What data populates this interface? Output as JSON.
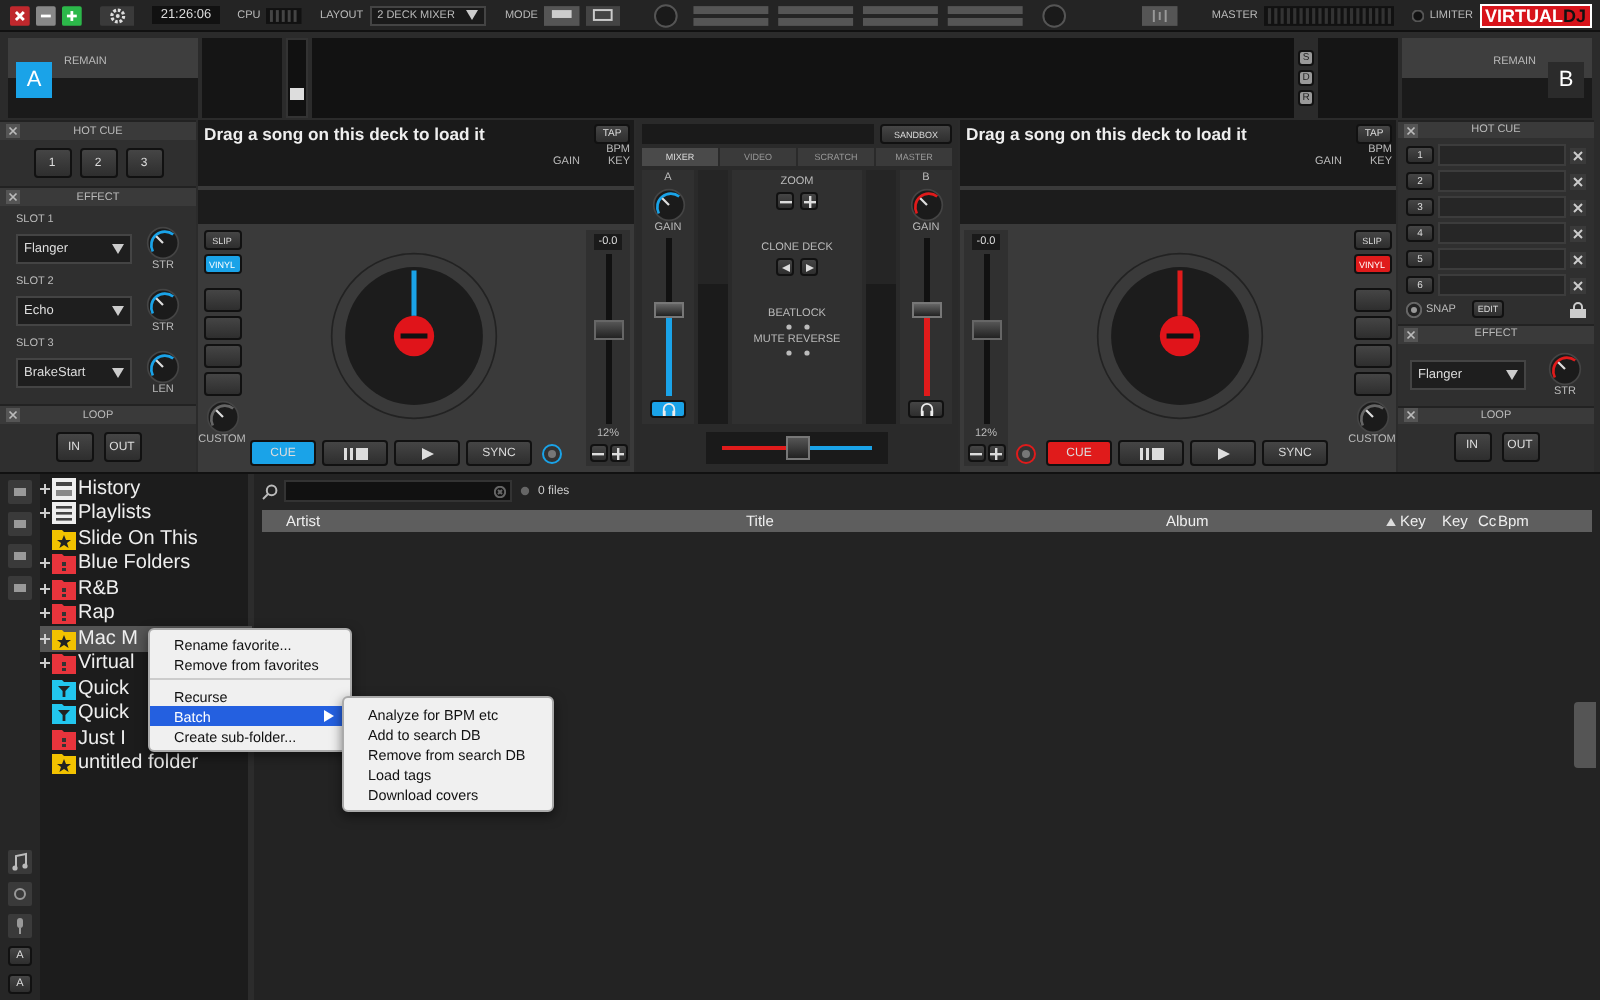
{
  "top_bar": {
    "clock": "21:26:06",
    "cpu_label": "CPU",
    "layout_label": "LAYOUT",
    "layout_value": "2 DECK MIXER",
    "mode_label": "MODE",
    "master_label": "MASTER",
    "limiter_label": "LIMITER",
    "logo": {
      "left": "VIRTUAL",
      "right": "DJ"
    }
  },
  "deck_headers": [
    {
      "letter": "A",
      "remain": "REMAIN",
      "color": "#1aa3e8"
    },
    {
      "letter": "B",
      "remain": "REMAIN",
      "color": "#2b2b2b"
    }
  ],
  "header_slider": {
    "level": 0.3
  },
  "view_buttons": [
    "S",
    "D",
    "R"
  ],
  "left_panel": {
    "hotcue_title": "HOT CUE",
    "hotcues": [
      "1",
      "2",
      "3"
    ],
    "effect_title": "EFFECT",
    "slots": [
      {
        "label": "SLOT 1",
        "effect": "Flanger",
        "knob": "STR"
      },
      {
        "label": "SLOT 2",
        "effect": "Echo",
        "knob": "STR"
      },
      {
        "label": "SLOT 3",
        "effect": "BrakeStart",
        "knob": "LEN"
      }
    ],
    "loop_title": "LOOP",
    "loop_buttons": [
      "IN",
      "OUT"
    ]
  },
  "decks": [
    {
      "color": "#1aa3e8",
      "message": "Drag a song on this deck to load it",
      "tap": "TAP",
      "bpm": "BPM",
      "gain": "GAIN",
      "key": "KEY",
      "slip": "SLIP",
      "vinyl": "VINYL",
      "vinyl_on": true,
      "custom": "CUSTOM",
      "pitch": "-0.0",
      "pitch_range": "12%",
      "pitch_slider": {
        "level": 0.55
      },
      "cue": "CUE",
      "sync": "SYNC"
    },
    {
      "color": "#e01b1b",
      "message": "Drag a song on this deck to load it",
      "tap": "TAP",
      "bpm": "BPM",
      "gain": "GAIN",
      "key": "KEY",
      "slip": "SLIP",
      "vinyl": "VINYL",
      "vinyl_on": true,
      "custom": "CUSTOM",
      "pitch": "-0.0",
      "pitch_range": "12%",
      "pitch_slider": {
        "level": 0.55
      },
      "cue": "CUE",
      "sync": "SYNC"
    }
  ],
  "mixer": {
    "sandbox": "SANDBOX",
    "tabs": [
      {
        "label": "MIXER",
        "selected": true
      },
      {
        "label": "VIDEO",
        "selected": false
      },
      {
        "label": "SCRATCH",
        "selected": false
      },
      {
        "label": "MASTER",
        "selected": false
      }
    ],
    "channels": [
      {
        "letter": "A",
        "gain": "GAIN",
        "color": "#1aa3e8",
        "level": 0.55,
        "headphone_on": true
      },
      {
        "letter": "B",
        "gain": "GAIN",
        "color": "#e01b1b",
        "level": 0.55,
        "headphone_on": false
      }
    ],
    "zoom": "ZOOM",
    "clone_deck": "CLONE DECK",
    "beatlock": "BEATLOCK",
    "mute_reverse": "MUTE REVERSE",
    "crossfader": {
      "level": 0.5
    }
  },
  "right_panel": {
    "hotcue_title": "HOT CUE",
    "hotcues": [
      "1",
      "2",
      "3",
      "4",
      "5",
      "6"
    ],
    "snap": "SNAP",
    "edit": "EDIT",
    "effect_title": "EFFECT",
    "effect": "Flanger",
    "knob": "STR",
    "loop_title": "LOOP",
    "loop_buttons": [
      "IN",
      "OUT"
    ]
  },
  "browser": {
    "sidebar_letters": [
      "A",
      "A"
    ],
    "tree": [
      {
        "label": "History",
        "kind": "history",
        "expandable": true,
        "selected": false
      },
      {
        "label": "Playlists",
        "kind": "playlist",
        "expandable": true,
        "selected": false
      },
      {
        "label": "Slide On This",
        "kind": "favorite",
        "expandable": false,
        "selected": false
      },
      {
        "label": "Blue Folders",
        "kind": "folder",
        "expandable": true,
        "selected": false
      },
      {
        "label": "R&B",
        "kind": "folder",
        "expandable": true,
        "selected": false
      },
      {
        "label": "Rap",
        "kind": "folder",
        "expandable": true,
        "selected": false
      },
      {
        "label": "Mac M",
        "kind": "favorite",
        "expandable": true,
        "selected": true
      },
      {
        "label": "Virtual",
        "kind": "folder",
        "expandable": true,
        "selected": false
      },
      {
        "label": "Quick",
        "kind": "filter",
        "expandable": false,
        "selected": false
      },
      {
        "label": "Quick",
        "kind": "filter",
        "expandable": false,
        "selected": false
      },
      {
        "label": "Just I",
        "kind": "folder",
        "expandable": false,
        "selected": false
      },
      {
        "label": "untitled folder",
        "kind": "favorite",
        "expandable": false,
        "selected": false
      }
    ],
    "file_count": "0 files",
    "columns": [
      {
        "label": "Artist",
        "sorted": false
      },
      {
        "label": "Title",
        "sorted": false
      },
      {
        "label": "Album",
        "sorted": false
      },
      {
        "label": "Key",
        "sorted": true
      },
      {
        "label": "Key",
        "sorted": false
      },
      {
        "label": "Cc",
        "sorted": false
      },
      {
        "label": "Bpm",
        "sorted": false
      }
    ]
  },
  "context_menu": {
    "items": [
      {
        "label": "Rename favorite...",
        "highlighted": false,
        "submenu": false,
        "separator_after": false
      },
      {
        "label": "Remove from favorites",
        "highlighted": false,
        "submenu": false,
        "separator_after": true
      },
      {
        "label": "Recurse",
        "highlighted": false,
        "submenu": false,
        "separator_after": false
      },
      {
        "label": "Batch",
        "highlighted": true,
        "submenu": true,
        "separator_after": false
      },
      {
        "label": "Create sub-folder...",
        "highlighted": false,
        "submenu": false,
        "separator_after": false
      }
    ],
    "submenu": [
      "Analyze for BPM etc",
      "Add to search DB",
      "Remove from search DB",
      "Load tags",
      "Download covers"
    ]
  }
}
